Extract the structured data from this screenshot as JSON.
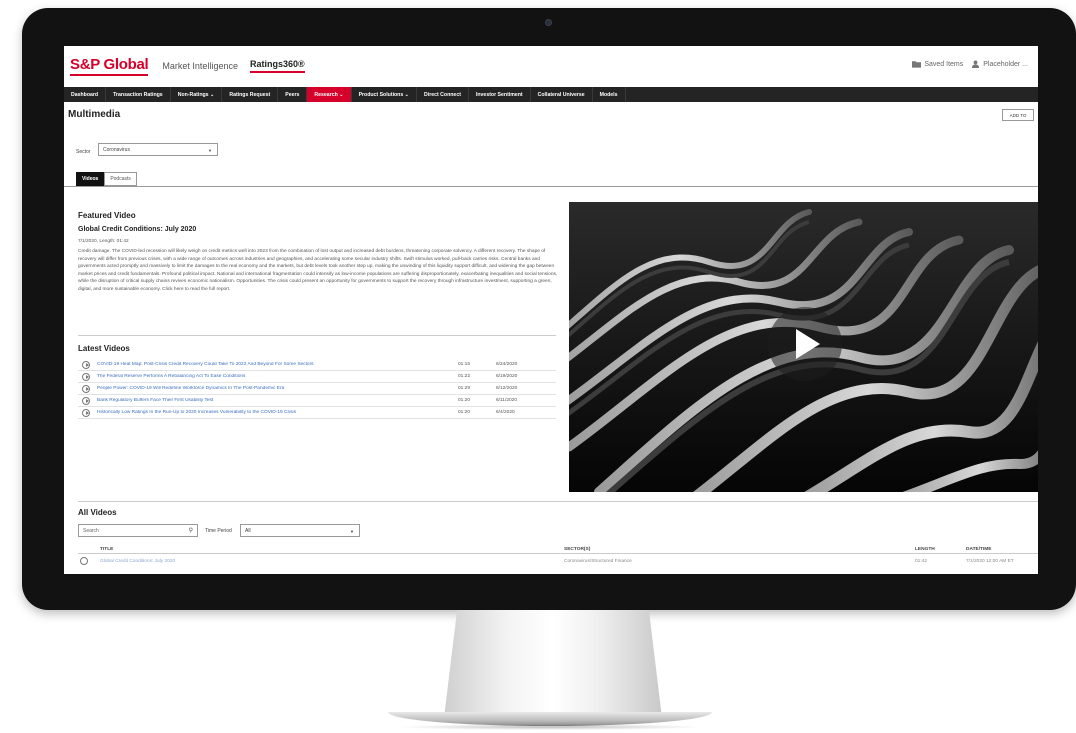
{
  "header": {
    "logo": "S&P Global",
    "market_intelligence": "Market Intelligence",
    "ratings360": "Ratings360®",
    "saved_items": "Saved Items",
    "user": "Placeholder ..."
  },
  "nav": {
    "items": [
      {
        "label": "Dashboard"
      },
      {
        "label": "Transaction Ratings"
      },
      {
        "label": "Non-Ratings ⌄"
      },
      {
        "label": "Ratings Request"
      },
      {
        "label": "Peers"
      },
      {
        "label": "Research ⌄"
      },
      {
        "label": "Product Solutions ⌄"
      },
      {
        "label": "Direct Connect"
      },
      {
        "label": "Investor Sentiment"
      },
      {
        "label": "Collateral Universe"
      },
      {
        "label": "Models"
      }
    ],
    "active_index": 5,
    "accent_color": "#d6002a"
  },
  "page": {
    "title": "Multimedia",
    "add_to": "ADD TO",
    "sector_label": "Sector",
    "sector_value": "Coronavirus"
  },
  "tabs": {
    "videos": "Videos",
    "podcasts": "Podcasts"
  },
  "featured": {
    "heading": "Featured Video",
    "title": "Global Credit Conditions: July 2020",
    "meta": "7/1/2020, Length: 01:42",
    "description": "Credit damage. The COVID-led recession will likely weigh on credit metrics well into 2023 from the combination of lost output and increased debt burdens, threatening corporate solvency. A different recovery. The shape of recovery will differ from previous crises, with a wide range of outcomes across industries and geographies, and accelerating some secular industry shifts. Swift stimulus worked, pull-back carries risks. Central banks and governments acted promptly and massively to limit the damages to the real economy and the markets, but debt levels took another step up, making the unwinding of this liquidity support difficult, and widening the gap between market prices and credit fundamentals. Profound political impact. National and international fragmentation could intensify as low-income populations are suffering disproportionately, exacerbating inequalities and social tensions, while the disruption of critical supply chains revives economic nationalism. Opportunities. The crisis could present an opportunity for governments to support the recovery through infrastructure investment, supporting a green, digital, and more sustainable economy. Click here to read the full report."
  },
  "latest": {
    "heading": "Latest Videos",
    "rows": [
      {
        "title": "COVID-19 Heat Map: Post-Crisis Credit Recovery Could Take To 2022 And Beyond For Some Sectors",
        "length": "01:15",
        "date": "6/24/2020"
      },
      {
        "title": "The Federal Reserve Performs A Rebalancing Act To Ease Conditions",
        "length": "01:22",
        "date": "6/19/2020"
      },
      {
        "title": "People Power: COVID-19 Will Redefine Workforce Dynamics In The Post-Pandemic Era",
        "length": "01:29",
        "date": "6/12/2020"
      },
      {
        "title": "Bank Regulatory Buffers Face Their First Usability Test",
        "length": "01:20",
        "date": "6/11/2020"
      },
      {
        "title": "Historically Low Ratings In the Run-Up to 2020 Increases Vulnerability to the COVID-19 Crisis",
        "length": "01:20",
        "date": "6/4/2020"
      }
    ]
  },
  "all_videos": {
    "heading": "All Videos",
    "search_placeholder": "Search",
    "time_period_label": "Time Period",
    "time_period_value": "All",
    "columns": {
      "title": "TITLE",
      "sectors": "SECTOR(S)",
      "length": "LENGTH",
      "datetime": "DATE/TIME"
    },
    "rows": [
      {
        "title": "Global Credit Conditions: July 2020",
        "sectors": "Coronavirus/Structured Finance",
        "length": "01:42",
        "datetime": "7/1/2020 12:00 AM ET"
      }
    ]
  }
}
